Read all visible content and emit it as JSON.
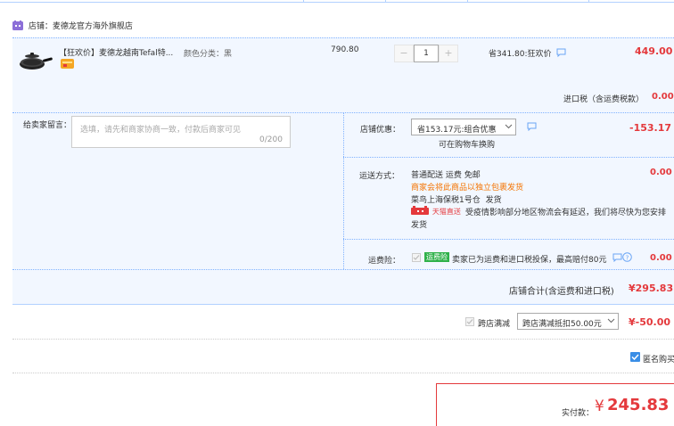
{
  "shop": {
    "label": "店铺：",
    "name": "麦德龙官方海外旗舰店"
  },
  "item": {
    "title": "【狂欢价】麦德龙越南Tefal特...",
    "sku": "颜色分类：黑",
    "unit_price": "790.80",
    "quantity": "1",
    "minus": "−",
    "plus": "+",
    "discount": "省341.80:狂欢价",
    "total": "449.00"
  },
  "tax": {
    "label": "进口税（含运费税款）",
    "value": "0.00"
  },
  "message": {
    "label": "给卖家留言：",
    "placeholder": "选填，请先和商家协商一致，付款后商家可见",
    "counter": "0/200"
  },
  "shop_discount": {
    "label": "店铺优惠：",
    "selected": "省153.17元:组合优惠",
    "note": "可在购物车换购",
    "value": "-153.17"
  },
  "shipping": {
    "label": "运送方式：",
    "method": "普通配送 运费 免邮",
    "notice": "商家会将此商品以独立包裹发货",
    "warehouse": "菜鸟上海保税1号仓",
    "warehouse_suffix": "发货",
    "badge": "天猫直送",
    "delay_note": "受疫情影响部分地区物流会有延迟，我们将尽快为您安排",
    "delay_note2": "发货",
    "value": "0.00"
  },
  "insurance": {
    "label": "运费险：",
    "tag": "运费险",
    "text": "卖家已为运费和进口税投保，最高赔付80元",
    "value": "0.00"
  },
  "shop_total": {
    "label": "店铺合计(含运费和进口税)",
    "value": "¥295.83"
  },
  "cross_store": {
    "label": "跨店满减",
    "selected": "跨店满减抵扣50.00元",
    "value": "¥-50.00"
  },
  "anonymous": {
    "label": "匿名购买"
  },
  "pay": {
    "label": "实付款：",
    "currency": "¥",
    "amount": "245.83"
  },
  "colors": {
    "accent_red": "#e4393c",
    "row_blue": "#f2f7ff",
    "border_blue": "#b2d1ff",
    "tmall_purple": "#8c6fd8",
    "insure_green": "#2fb14a",
    "notice_orange": "#f47300",
    "checkbox_blue": "#3a8ee6"
  }
}
